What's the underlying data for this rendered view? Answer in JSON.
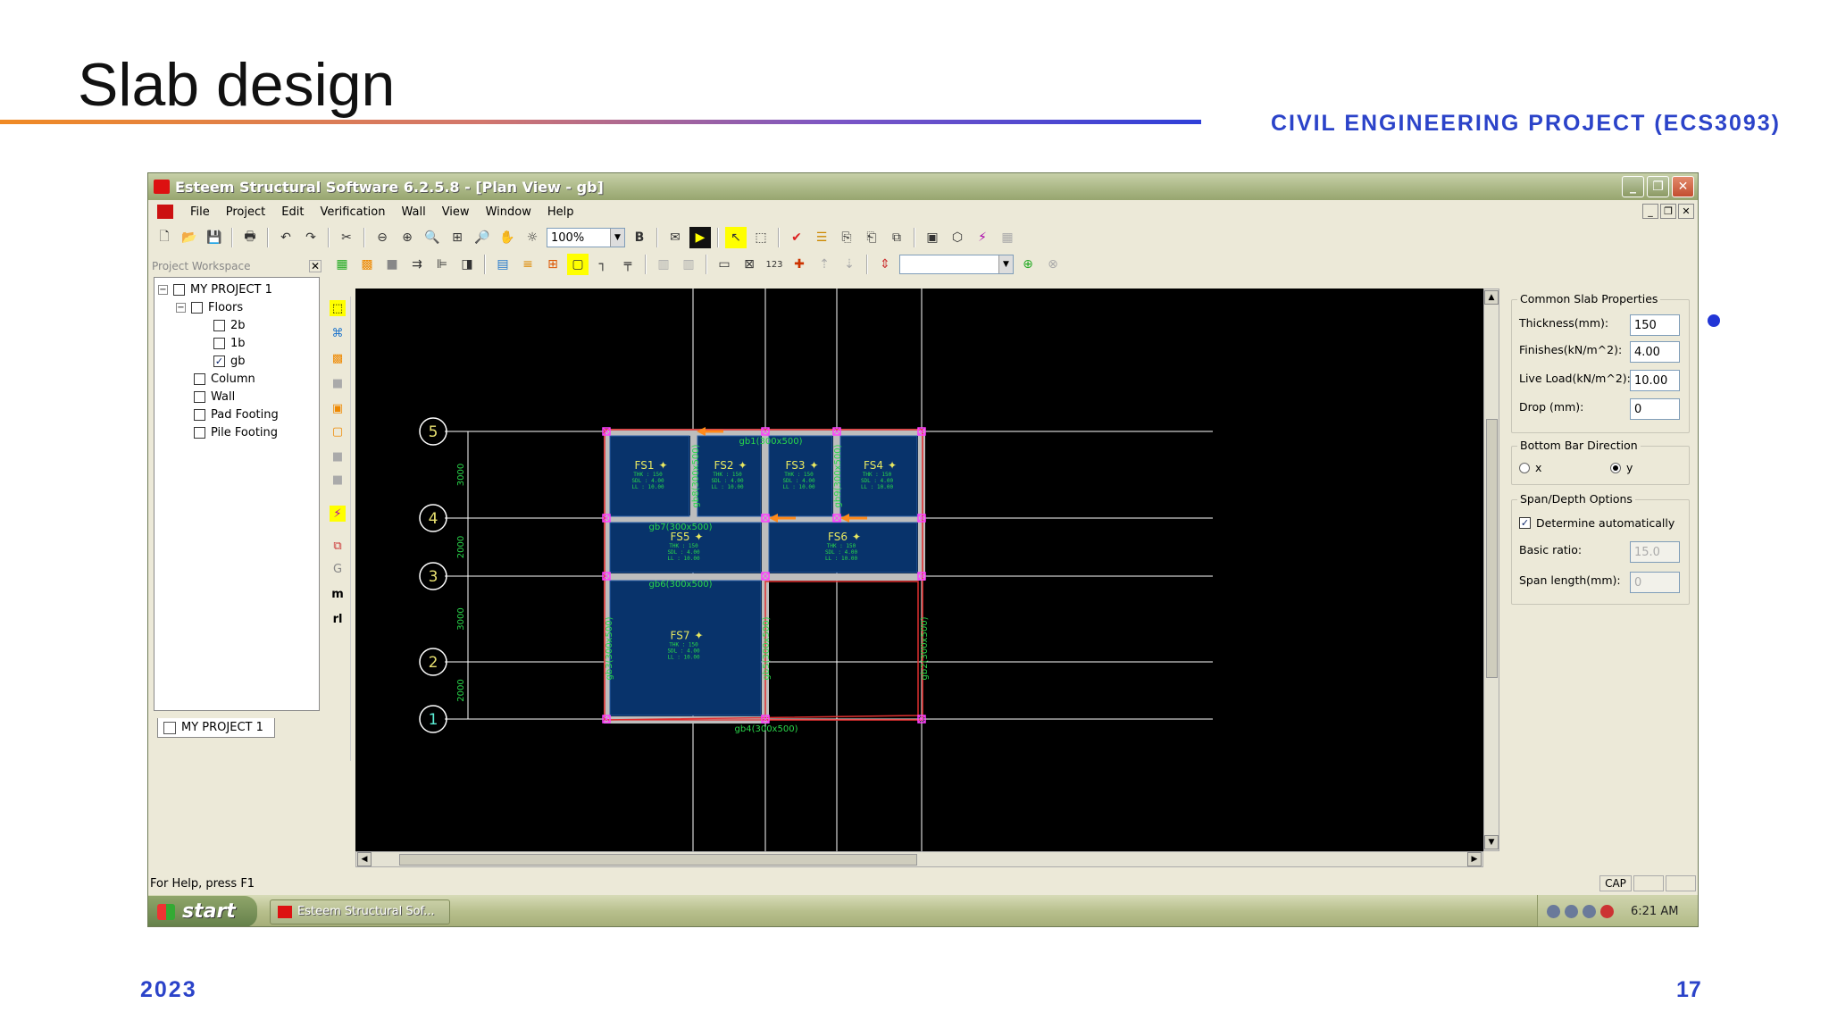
{
  "slide": {
    "title": "Slab design",
    "course": "CIVIL ENGINEERING PROJECT (ECS3093)",
    "year": "2023",
    "page_number": "17",
    "colors": {
      "accent": "#2b43c9",
      "line_start": "#f08a24",
      "line_end": "#2f3fd8"
    }
  },
  "window": {
    "title": "Esteem Structural Software 6.2.5.8 - [Plan View - gb]",
    "menus": [
      "File",
      "Project",
      "Edit",
      "Verification",
      "Wall",
      "View",
      "Window",
      "Help"
    ],
    "zoom": "100%",
    "bold_label": "B",
    "scale_label": "123"
  },
  "workspace": {
    "header": "Project Workspace",
    "tree": [
      {
        "label": "MY PROJECT 1",
        "level": 0,
        "checked": false,
        "expander": "−"
      },
      {
        "label": "Floors",
        "level": 1,
        "checked": false,
        "expander": "−"
      },
      {
        "label": "2b",
        "level": 2,
        "checked": false
      },
      {
        "label": "1b",
        "level": 2,
        "checked": false
      },
      {
        "label": "gb",
        "level": 2,
        "checked": true
      },
      {
        "label": "Column",
        "level": 1,
        "checked": false
      },
      {
        "label": "Wall",
        "level": 1,
        "checked": false
      },
      {
        "label": "Pad Footing",
        "level": 1,
        "checked": false
      },
      {
        "label": "Pile Footing",
        "level": 1,
        "checked": false
      }
    ],
    "tab_label": "MY PROJECT 1",
    "vtool_letters": [
      "G",
      "m",
      "rl"
    ]
  },
  "plan": {
    "grid_labels": [
      "5",
      "4",
      "3",
      "2",
      "1"
    ],
    "dimensions": [
      "3000",
      "2000",
      "3000",
      "2000"
    ],
    "slabs": [
      {
        "name": "FS1",
        "thk": "THK : 150",
        "sdl": "SDL : 4.00",
        "ll": "LL : 10.00"
      },
      {
        "name": "FS2",
        "thk": "THK : 150",
        "sdl": "SDL : 4.00",
        "ll": "LL : 10.00"
      },
      {
        "name": "FS3",
        "thk": "THK : 150",
        "sdl": "SDL : 4.00",
        "ll": "LL : 10.00"
      },
      {
        "name": "FS4",
        "thk": "THK : 150",
        "sdl": "SDL : 4.00",
        "ll": "LL : 10.00"
      },
      {
        "name": "FS5",
        "thk": "THK : 150",
        "sdl": "SDL : 4.00",
        "ll": "LL : 10.00"
      },
      {
        "name": "FS6",
        "thk": "THK : 150",
        "sdl": "SDL : 4.00",
        "ll": "LL : 10.00"
      },
      {
        "name": "FS7",
        "thk": "THK : 150",
        "sdl": "SDL : 4.00",
        "ll": "LL : 10.00"
      }
    ],
    "beams": [
      "gb1(300x500)",
      "gb7(300x500)",
      "gb6(300x500)",
      "gb4(300x500)",
      "gb8(300x500)",
      "gb9(300x500)",
      "gb3(300x500)",
      "gb5(300x500)",
      "gb2(300x500)"
    ],
    "colors": {
      "slab_fill": "#08336b",
      "beam": "#bdbdbd",
      "grid": "#ffffff",
      "label": "#29d84a",
      "column": "#ff40ff",
      "outline": "#e03030"
    }
  },
  "properties": {
    "common_title": "Common Slab Properties",
    "fields": [
      {
        "label": "Thickness(mm):",
        "value": "150"
      },
      {
        "label": "Finishes(kN/m^2):",
        "value": "4.00"
      },
      {
        "label": "Live Load(kN/m^2):",
        "value": "10.00"
      },
      {
        "label": "Drop (mm):",
        "value": "0"
      }
    ],
    "bottom_bar_title": "Bottom Bar Direction",
    "direction_options": [
      "x",
      "y"
    ],
    "direction_selected": "y",
    "span_title": "Span/Depth Options",
    "auto_label": "Determine automatically",
    "auto_checked": true,
    "basic_ratio_label": "Basic ratio:",
    "basic_ratio_value": "15.0",
    "span_length_label": "Span length(mm):",
    "span_length_value": "0"
  },
  "status": {
    "help_text": "For Help, press F1",
    "cap": "CAP"
  },
  "taskbar": {
    "start": "start",
    "task": "Esteem Structural Sof...",
    "clock": "6:21 AM"
  }
}
